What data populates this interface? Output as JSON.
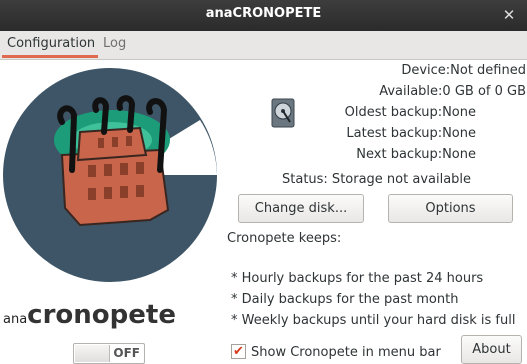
{
  "window": {
    "title": "anaCRONOPETE",
    "close_glyph": "✕"
  },
  "tabs": [
    {
      "label": "Configuration"
    },
    {
      "label": "Log"
    }
  ],
  "brand": {
    "prefix": "ana",
    "name": "cronopete"
  },
  "toggle": {
    "label": "OFF",
    "state": "off"
  },
  "info": {
    "device": "Device:Not defined",
    "available": "Available:0 GB of 0 GB",
    "oldest": "Oldest backup:None",
    "latest": "Latest backup:None",
    "next": "Next backup:None"
  },
  "status": "Status: Storage not available",
  "buttons": {
    "change_disk": "Change disk...",
    "options": "Options",
    "about": "About"
  },
  "keeps": {
    "title": "Cronopete keeps:",
    "items": [
      "* Hourly backups for the past 24 hours",
      "* Daily backups for the past month",
      "* Weekly backups until your hard disk is full"
    ]
  },
  "menu_bar": {
    "label": "Show Cronopete in menu bar",
    "checked": true,
    "check_glyph": "✔"
  },
  "colors": {
    "accent": "#e06a4f",
    "titlebar": "#2b2b2b",
    "logo_ring": "#3d5566",
    "building": "#c8654a"
  },
  "icons": {
    "logo": "cronopete-logo-icon",
    "disk": "hard-disk-icon"
  }
}
